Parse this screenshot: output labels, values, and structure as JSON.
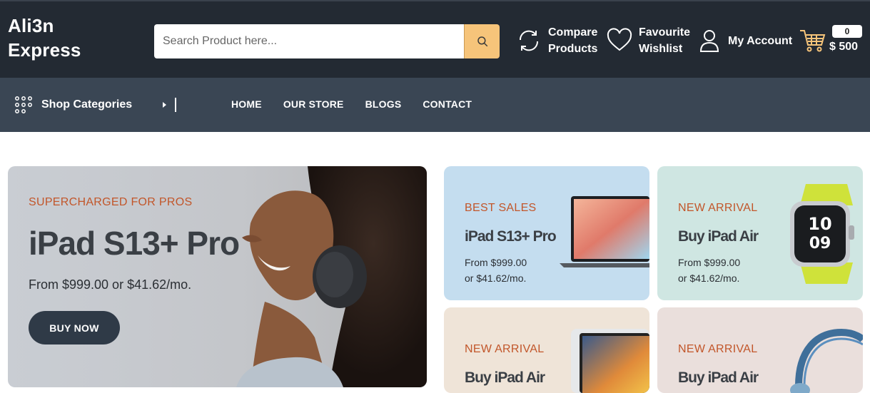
{
  "brand": {
    "line1": "Ali3n",
    "line2": "Express"
  },
  "search": {
    "placeholder": "Search Product here..."
  },
  "header": {
    "compare_line1": "Compare",
    "compare_line2": "Products",
    "wishlist_line1": "Favourite",
    "wishlist_line2": "Wishlist",
    "account_label": "My Account",
    "cart_count": "0",
    "cart_total": "$ 500"
  },
  "nav": {
    "shop_categories": "Shop Categories",
    "menu": [
      "HOME",
      "OUR STORE",
      "BLOGS",
      "CONTACT"
    ]
  },
  "hero": {
    "eyebrow": "SUPERCHARGED FOR PROS",
    "title": "iPad S13+ Pro",
    "price": "From $999.00 or $41.62/mo.",
    "button": "BUY NOW"
  },
  "cards": [
    {
      "eyebrow": "BEST SALES",
      "title": "iPad S13+ Pro",
      "line1": "From $999.00",
      "line2": "or $41.62/mo."
    },
    {
      "eyebrow": "NEW ARRIVAL",
      "title": "Buy iPad Air",
      "line1": "From $999.00",
      "line2": "or $41.62/mo."
    },
    {
      "eyebrow": "NEW ARRIVAL",
      "title": "Buy iPad Air"
    },
    {
      "eyebrow": "NEW ARRIVAL",
      "title": "Buy iPad Air"
    }
  ],
  "colors": {
    "header_bg": "#232a33",
    "nav_bg": "#3a4654",
    "accent": "#f6c47a",
    "eyebrow": "#c2562a",
    "button": "#2f3a47"
  },
  "icons": [
    "search-icon",
    "compare-icon",
    "heart-icon",
    "user-icon",
    "cart-icon",
    "grid-dots-icon"
  ]
}
